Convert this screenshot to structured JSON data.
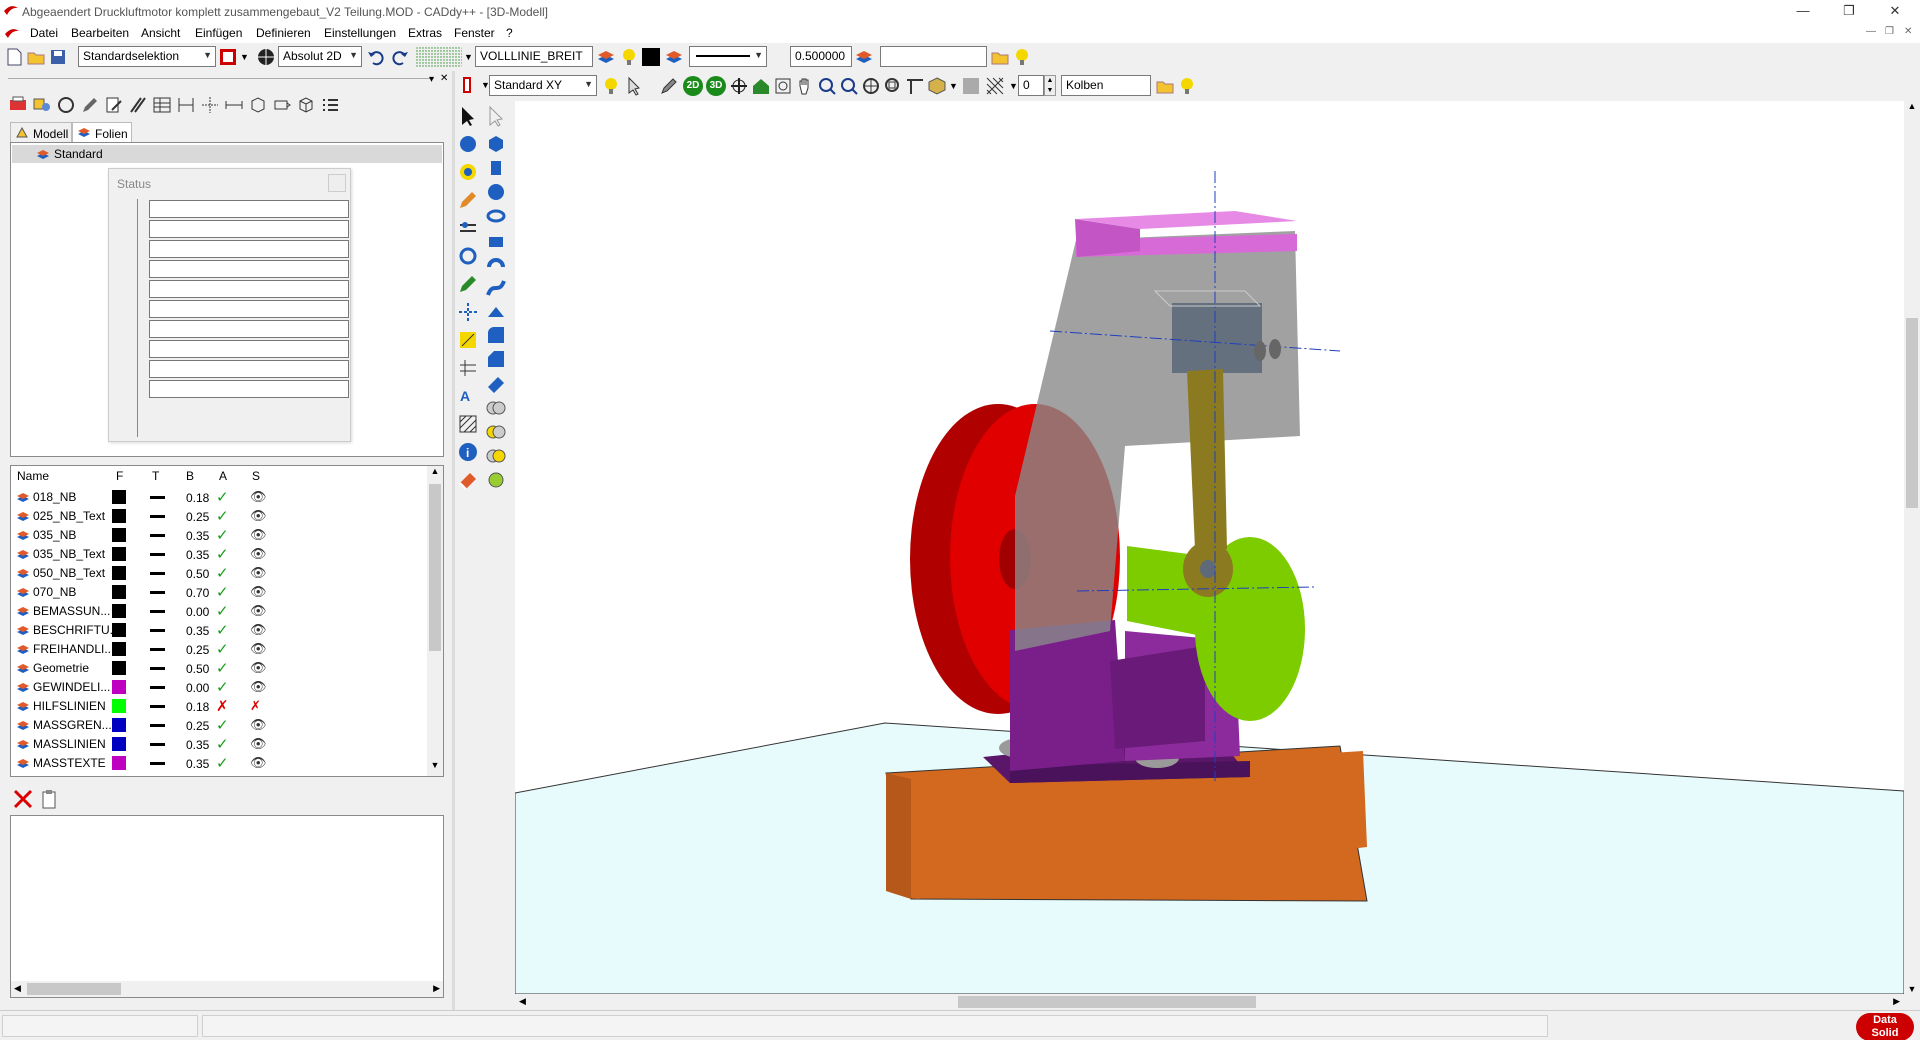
{
  "window": {
    "title": "Abgeaendert Druckluftmotor komplett zusammengebaut_V2 Teilung.MOD  -  CADdy++ - [3D-Modell]",
    "minimize": "—",
    "restore": "❐",
    "close": "✕"
  },
  "menu": {
    "items": [
      "Datei",
      "Bearbeiten",
      "Ansicht",
      "Einfügen",
      "Definieren",
      "Einstellungen",
      "Extras",
      "Fenster",
      "?"
    ]
  },
  "toolbar1": {
    "selection_mode": "Standardselektion",
    "coord_mode": "Absolut 2D",
    "linetype_name": "VOLLLINIE_BREIT",
    "line_width": "0.500000",
    "extra_field": ""
  },
  "toolbar2": {
    "view": "Standard XY",
    "number": "0",
    "part_name": "Kolben",
    "btn_2d": "2D",
    "btn_3d": "3D"
  },
  "left": {
    "tabs": [
      "Modell",
      "Folien"
    ],
    "tree_root": "Standard",
    "status_title": "Status"
  },
  "layers": {
    "headers": [
      "Name",
      "F",
      "T",
      "B",
      "A",
      "S"
    ],
    "rows": [
      {
        "name": "018_NB",
        "color": "#000000",
        "width": "0.18",
        "active": "✓",
        "visible": "👁"
      },
      {
        "name": "025_NB_Text",
        "color": "#000000",
        "width": "0.25",
        "active": "✓",
        "visible": "👁"
      },
      {
        "name": "035_NB",
        "color": "#000000",
        "width": "0.35",
        "active": "✓",
        "visible": "👁"
      },
      {
        "name": "035_NB_Text",
        "color": "#000000",
        "width": "0.35",
        "active": "✓",
        "visible": "👁"
      },
      {
        "name": "050_NB_Text",
        "color": "#000000",
        "width": "0.50",
        "active": "✓",
        "visible": "👁"
      },
      {
        "name": "070_NB",
        "color": "#000000",
        "width": "0.70",
        "active": "✓",
        "visible": "👁"
      },
      {
        "name": "BEMASSUN...",
        "color": "#000000",
        "width": "0.00",
        "active": "✓",
        "visible": "👁"
      },
      {
        "name": "BESCHRIFTU...",
        "color": "#000000",
        "width": "0.35",
        "active": "✓",
        "visible": "👁"
      },
      {
        "name": "FREIHANDLI...",
        "color": "#000000",
        "width": "0.25",
        "active": "✓",
        "visible": "👁"
      },
      {
        "name": "Geometrie",
        "color": "#000000",
        "width": "0.50",
        "active": "✓",
        "visible": "👁"
      },
      {
        "name": "GEWINDELI...",
        "color": "#c000c0",
        "width": "0.00",
        "active": "✓",
        "visible": "👁"
      },
      {
        "name": "HILFSLINIEN",
        "color": "#00ff00",
        "width": "0.18",
        "active": "✗",
        "visible": "✗"
      },
      {
        "name": "MASSGREN...",
        "color": "#0000c0",
        "width": "0.25",
        "active": "✓",
        "visible": "👁"
      },
      {
        "name": "MASSLINIEN",
        "color": "#0000c0",
        "width": "0.35",
        "active": "✓",
        "visible": "👁"
      },
      {
        "name": "MASSTEXTE",
        "color": "#c000c0",
        "width": "0.35",
        "active": "✓",
        "visible": "👁"
      }
    ]
  },
  "brand": {
    "line1": "Data",
    "line2": "Solid"
  },
  "colors": {
    "base_orange": "#d2691e",
    "flywheel_red": "#e00000",
    "housing_purple": "#7a1f8a",
    "top_pink": "#d86ad8",
    "crank_green": "#7ccc00",
    "floor_cyan": "#e8fbfc"
  }
}
